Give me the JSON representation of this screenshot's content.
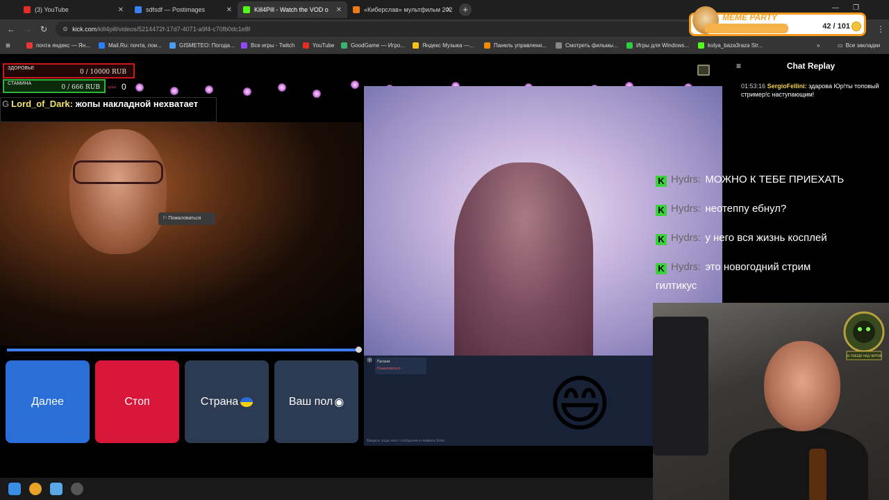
{
  "browser": {
    "tabs": [
      {
        "label": "(3) YouTube",
        "color": "#e52d27"
      },
      {
        "label": "sdfsdf — Postimages",
        "color": "#3b82f6"
      },
      {
        "label": "Kill4Pill - Watch the VOD o",
        "color": "#53fc18",
        "active": true
      },
      {
        "label": "«Киберслав» мультфильм 202",
        "color": "#f07a1a"
      }
    ],
    "url_domain": "kick.com",
    "url_path": "/kill4pill/videos/5214472f-17d7-4071-a9f4-c70fb0dc1e8f",
    "bookmarks": [
      {
        "label": "почта яндекс — Ян...",
        "color": "#e53935"
      },
      {
        "label": "Mail.Ru: почта, пои...",
        "color": "#2a7fff"
      },
      {
        "label": "GISMETEO: Погода...",
        "color": "#4a9df0"
      },
      {
        "label": "Все игры - Twitch",
        "color": "#9146ff"
      },
      {
        "label": "YouTube",
        "color": "#e52d27"
      },
      {
        "label": "GoodGame — Игро...",
        "color": "#3cb371"
      },
      {
        "label": "Яндекс Музыка —...",
        "color": "#f5c518"
      },
      {
        "label": "Панель управлени...",
        "color": "#f28b00"
      },
      {
        "label": "Смотреть фильмы...",
        "color": "#888888"
      },
      {
        "label": "Игры для Windows...",
        "color": "#2ecc40"
      },
      {
        "label": "kolya_baza3raza Str...",
        "color": "#53fc18"
      }
    ],
    "all_bookmarks": "Все закладки"
  },
  "hud": {
    "health_label": "ЗДОРОВЬЕ",
    "health_value": "0 / 10000 RUB",
    "stamina_label": "СТАМИНА",
    "stamina_value": "0 / 666 RUB",
    "counter": "0"
  },
  "overlay_chat": {
    "user": "Lord_of_Dark:",
    "message": "жопы накладной нехватает"
  },
  "report_button": "Пожаловаться",
  "roulette_buttons": {
    "next": "Далее",
    "stop": "Стоп",
    "country": "Страна",
    "gender": "Ваш пол"
  },
  "video_progress": 0.99,
  "mini_chat": {
    "line1": "Пытаем",
    "line2": "Пожаловаться",
    "hint": "Введите сюда текст сообщения и нажмите Enter"
  },
  "chat_replay": {
    "title": "Chat Replay",
    "messages": [
      {
        "time": "01:53:16",
        "user": "SergioFellini:",
        "text": "здарова Юр!ты топовый стример!с наступающим!"
      }
    ]
  },
  "overlay_lines": [
    {
      "user": "Hydrs:",
      "text": "МОЖНО К ТЕБЕ ПРИЕХАТЬ"
    },
    {
      "user": "Hydrs:",
      "text": "неотеппу ебнул?"
    },
    {
      "user": "Hydrs:",
      "text": "у него вся жизнь косплей"
    },
    {
      "user": "Hydrs:",
      "text": "это новогодний стрим"
    }
  ],
  "overlay_tail": "гилтикус",
  "meme_party": {
    "title": "MEME PARTY",
    "count": "42 / 101"
  },
  "badge_text": "ЗА ПОБЕДУ НАД ЧЕРТОМ",
  "emoji": "😄"
}
